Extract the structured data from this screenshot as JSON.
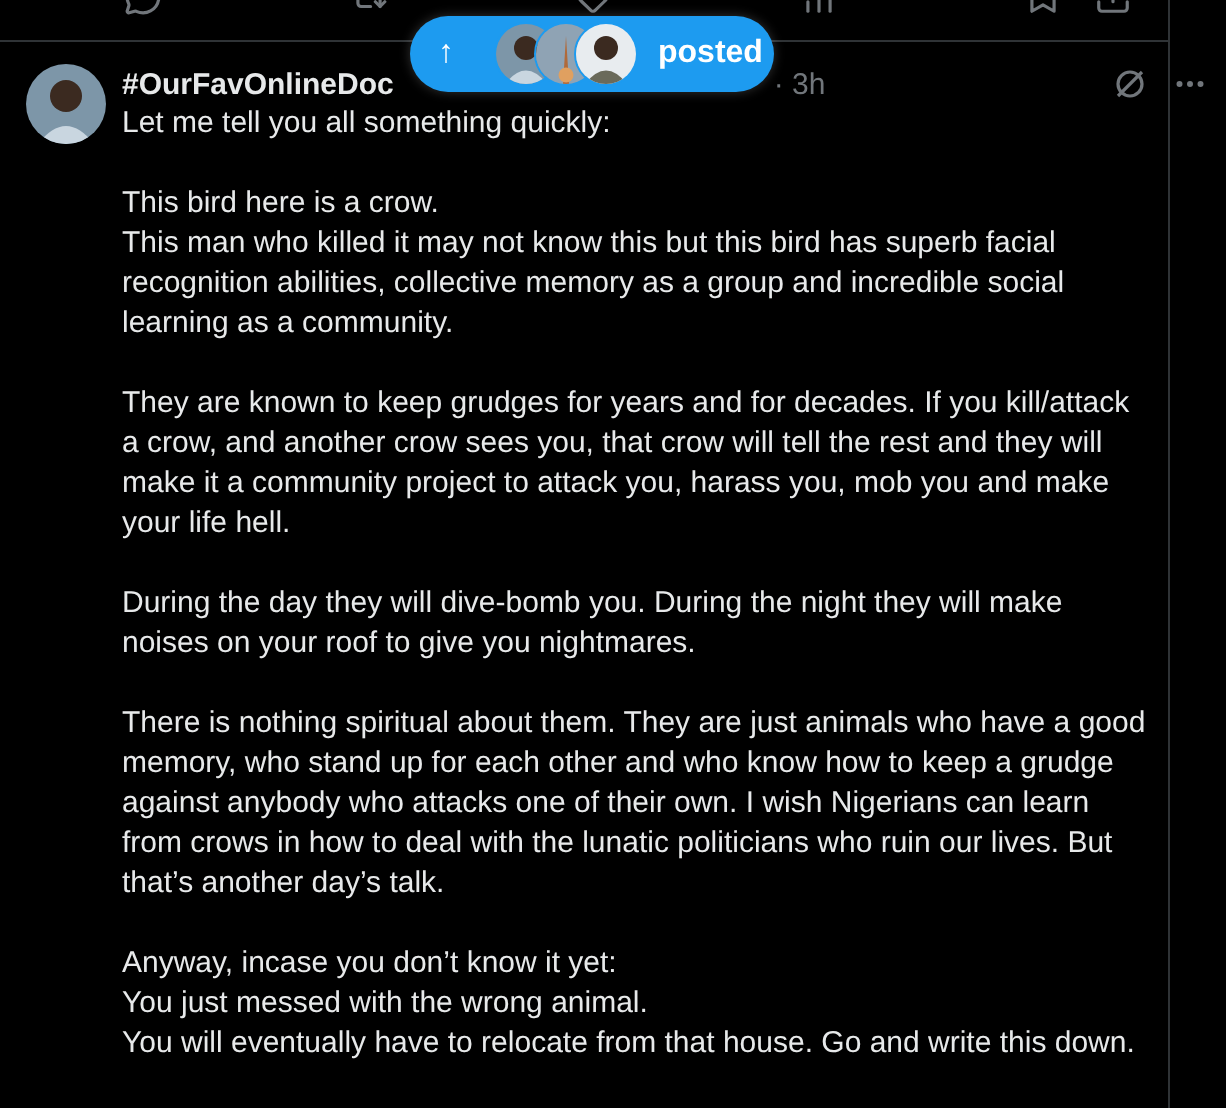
{
  "new_posts_pill": {
    "label": "posted",
    "arrow": "↑"
  },
  "post": {
    "display_name": "#OurFavOnlineDoc",
    "meta": "· 3h",
    "paragraphs": [
      "Let me tell you all something quickly:",
      "This bird here is a crow.\nThis man who killed it may not know this but this bird has superb facial recognition abilities, collective memory as a group and incredible social learning as a community.",
      "They are known to keep grudges for years and for decades. If you kill/attack a crow, and another crow sees you, that crow will tell the rest and they will make it a community project to attack you, harass you, mob you and make your life hell.",
      "During the day they will dive-bomb you. During the night they will make noises on your roof to give you nightmares.",
      "There is nothing spiritual about them. They are just animals who have a good memory, who stand up for each other and who know how to keep a grudge against anybody who attacks one of their own. I wish Nigerians can learn from crows in how to deal with the lunatic politicians who ruin our lives. But that’s another day’s talk.",
      "Anyway, incase you don’t know it yet:\nYou just messed with the wrong animal.\nYou will eventually have to relocate from that house. Go and write this down."
    ]
  }
}
